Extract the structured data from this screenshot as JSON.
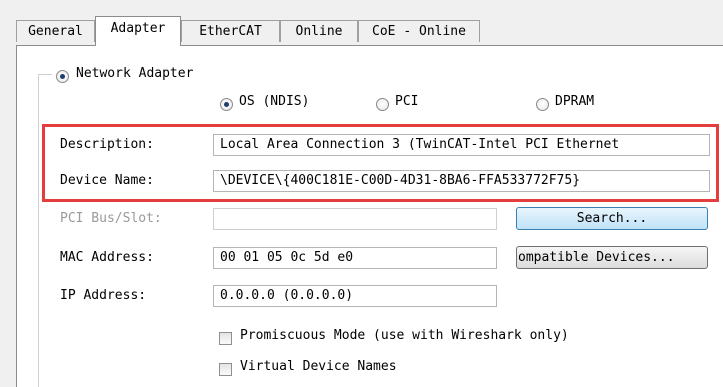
{
  "tabs": [
    {
      "label": "General",
      "active": false
    },
    {
      "label": "Adapter",
      "active": true
    },
    {
      "label": "EtherCAT",
      "active": false
    },
    {
      "label": "Online",
      "active": false
    },
    {
      "label": "CoE - Online",
      "active": false
    }
  ],
  "adapter": {
    "network_adapter_label": "Network Adapter",
    "network_adapter_selected": true,
    "bind_options": [
      {
        "label": "OS (NDIS)",
        "selected": true
      },
      {
        "label": "PCI",
        "selected": false
      },
      {
        "label": "DPRAM",
        "selected": false
      }
    ],
    "description": {
      "label": "Description:",
      "value": "Local Area Connection 3 (TwinCAT-Intel PCI Ethernet"
    },
    "device_name": {
      "label": "Device Name:",
      "value": "\\DEVICE\\{400C181E-C00D-4D31-8BA6-FFA533772F75}"
    },
    "pci_bus_slot": {
      "label": "PCI Bus/Slot:",
      "value": "",
      "enabled": false
    },
    "search_button": "Search...",
    "mac_address": {
      "label": "MAC Address:",
      "value": "00 01 05 0c 5d e0"
    },
    "compatible_devices_button": "ompatible Devices...",
    "ip_address": {
      "label": "IP Address:",
      "value": "0.0.0.0 (0.0.0.0)"
    },
    "promiscuous_mode": {
      "label": "Promiscuous Mode (use with Wireshark only)",
      "checked": false
    },
    "virtual_device_names": {
      "label": "Virtual Device Names",
      "checked": false
    }
  },
  "colors": {
    "highlight": "#e43d3d",
    "radio_dot": "#1f3c6e",
    "focused_button": "#bfe2f8"
  }
}
